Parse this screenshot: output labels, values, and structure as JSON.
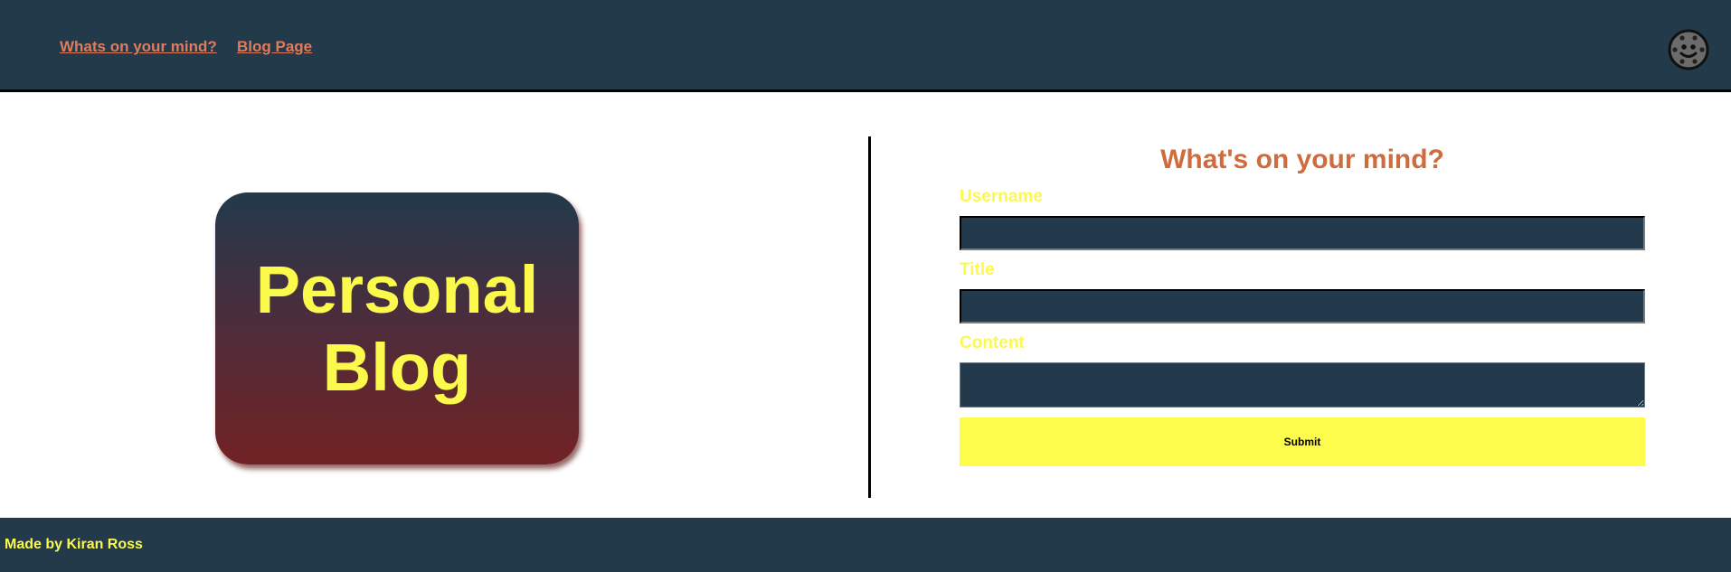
{
  "nav": {
    "links": [
      {
        "label": "Whats on your mind?"
      },
      {
        "label": "Blog Page"
      }
    ],
    "avatar_icon": "smiley-face-icon"
  },
  "hero": {
    "logo_text": "Personal Blog"
  },
  "form": {
    "title": "What's on your mind?",
    "username_label": "Username",
    "title_label": "Title",
    "content_label": "Content",
    "username_value": "",
    "title_value": "",
    "content_value": "",
    "submit_label": "Submit"
  },
  "footer": {
    "text": "Made by Kiran Ross"
  },
  "colors": {
    "navy": "#233a4b",
    "accent_yellow": "#fcf94d",
    "link_orange": "#e07b5c",
    "heading_orange": "#cf6c3d",
    "logo_bottom": "#722224"
  }
}
